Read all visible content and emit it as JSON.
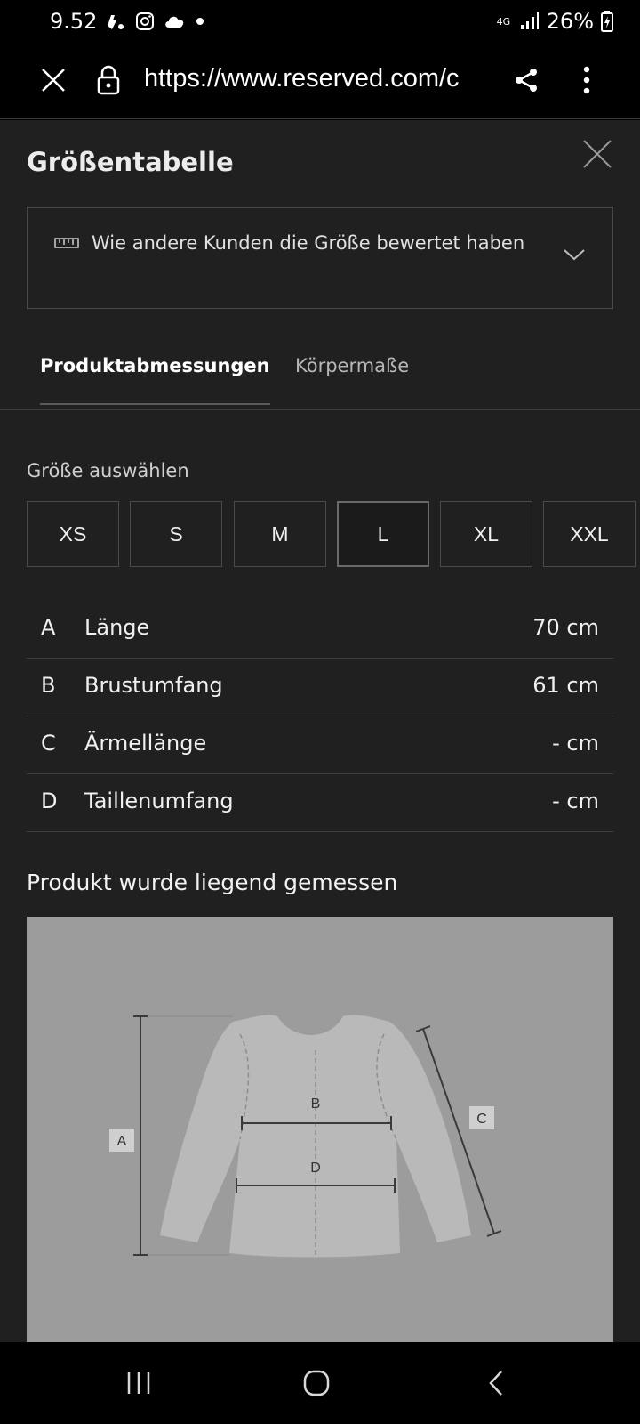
{
  "status_bar": {
    "time": "9.52",
    "network": "4G",
    "battery": "26%",
    "icons": [
      "notification-icon",
      "instagram-icon",
      "cloud-icon",
      "dot-icon",
      "network-4g-icon",
      "signal-icon",
      "battery-charging-icon"
    ]
  },
  "browser": {
    "url": "https://www.reserved.com/c",
    "icons": [
      "close-icon",
      "lock-icon",
      "share-icon",
      "more-vert-icon"
    ]
  },
  "sheet": {
    "title": "Größentabelle",
    "rating_text": "Wie andere Kunden die Größe bewertet haben",
    "tabs": [
      {
        "label": "Produktabmessungen",
        "active": true
      },
      {
        "label": "Körpermaße",
        "active": false
      }
    ],
    "size_label": "Größe auswählen",
    "sizes": [
      {
        "label": "XS",
        "selected": false
      },
      {
        "label": "S",
        "selected": false
      },
      {
        "label": "M",
        "selected": false
      },
      {
        "label": "L",
        "selected": true
      },
      {
        "label": "XL",
        "selected": false
      },
      {
        "label": "XXL",
        "selected": false
      }
    ],
    "measurements": [
      {
        "letter": "A",
        "name": "Länge",
        "value": "70 cm"
      },
      {
        "letter": "B",
        "name": "Brustumfang",
        "value": "61 cm"
      },
      {
        "letter": "C",
        "name": "Ärmellänge",
        "value": "- cm"
      },
      {
        "letter": "D",
        "name": "Taillenumfang",
        "value": "- cm"
      }
    ],
    "lying_note": "Produkt wurde liegend gemessen",
    "diagram_labels": {
      "a": "A",
      "b": "B",
      "c": "C",
      "d": "D"
    }
  },
  "colors": {
    "sheet_bg": "#202021",
    "figure_bg": "#9c9c9c",
    "garment": "#b9b9b9"
  }
}
